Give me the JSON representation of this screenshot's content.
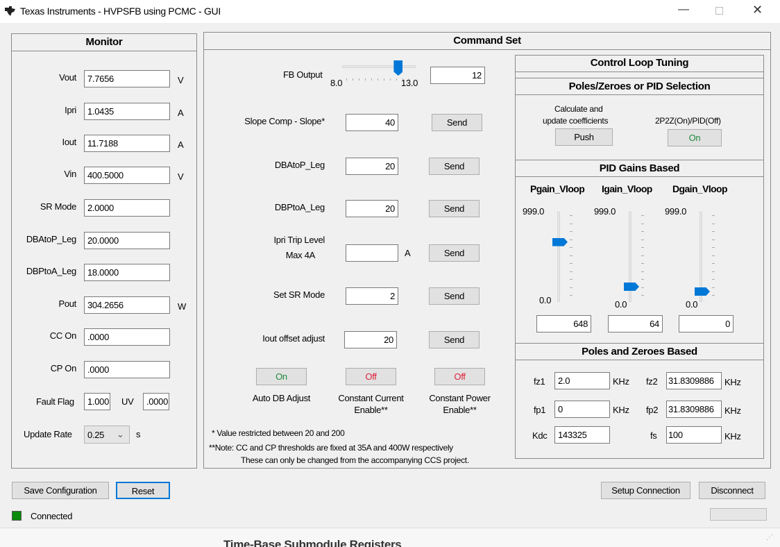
{
  "window": {
    "title": "Texas Instruments - HVPSFB using PCMC - GUI"
  },
  "monitor": {
    "title": "Monitor",
    "rows": [
      {
        "label": "Vout",
        "value": "7.7656",
        "unit": "V"
      },
      {
        "label": "Ipri",
        "value": "1.0435",
        "unit": "A"
      },
      {
        "label": "Iout",
        "value": "11.7188",
        "unit": "A"
      },
      {
        "label": "Vin",
        "value": "400.5000",
        "unit": "V"
      },
      {
        "label": "SR Mode",
        "value": "2.0000",
        "unit": ""
      },
      {
        "label": "DBAtoP_Leg",
        "value": "20.0000",
        "unit": ""
      },
      {
        "label": "DBPtoA_Leg",
        "value": "18.0000",
        "unit": ""
      },
      {
        "label": "Pout",
        "value": "304.2656",
        "unit": "W"
      },
      {
        "label": "CC On",
        "value": ".0000",
        "unit": ""
      },
      {
        "label": "CP On",
        "value": ".0000",
        "unit": ""
      }
    ],
    "fault_label": "Fault Flag",
    "fault_value": "1.000",
    "uv_label": "UV",
    "uv_value": ".0000",
    "update_label": "Update Rate",
    "update_value": "0.25",
    "update_unit": "s"
  },
  "command": {
    "title": "Command Set",
    "fb": {
      "label": "FB Output",
      "min": "8.0",
      "max": "13.0",
      "value": "12",
      "fraction": 0.8
    },
    "rows": [
      {
        "label": "Slope Comp - Slope*",
        "value": "40",
        "unit": "",
        "send": "Send"
      },
      {
        "label": "DBAtoP_Leg",
        "value": "20",
        "unit": "",
        "send": "Send"
      },
      {
        "label": "DBPtoA_Leg",
        "value": "20",
        "unit": "",
        "send": "Send"
      },
      {
        "label": "Ipri Trip Level",
        "label2": "Max 4A",
        "value": "",
        "unit": "A",
        "send": "Send"
      },
      {
        "label": "Set SR Mode",
        "value": "2",
        "unit": "",
        "send": "Send"
      },
      {
        "label": "Iout offset adjust",
        "value": "20",
        "unit": "",
        "send": "Send"
      }
    ],
    "toggles": [
      {
        "state": "On",
        "label": "Auto DB Adjust",
        "label2": ""
      },
      {
        "state": "Off",
        "label": "Constant Current",
        "label2": "Enable**"
      },
      {
        "state": "Off",
        "label": "Constant Power",
        "label2": "Enable**"
      }
    ],
    "note1": "* Value restricted between 20 and 200",
    "note2": "**Note: CC and CP thresholds are fixed  at 35A and 400W respectively",
    "note3": "These can only be changed from the accompanying CCS project."
  },
  "tuning": {
    "title": "Control Loop Tuning",
    "selection_title": "Poles/Zeroes or PID Selection",
    "calc_label1": "Calculate and",
    "calc_label2": "update coefficients",
    "push": "Push",
    "mode_label": "2P2Z(On)/PID(Off)",
    "mode_state": "On",
    "pid_title": "PID Gains Based",
    "gains": [
      {
        "label": "Pgain_Vloop",
        "max": "999.0",
        "min": "0.0",
        "value": "648"
      },
      {
        "label": "Igain_Vloop",
        "max": "999.0",
        "min": "0.0",
        "value": "64"
      },
      {
        "label": "Dgain_Vloop",
        "max": "999.0",
        "min": "0.0",
        "value": "0"
      }
    ],
    "pz_title": "Poles and Zeroes Based",
    "pz": {
      "fz1": "2.0",
      "fz2": "31.8309886",
      "fp1": "0",
      "fp2": "31.8309886",
      "kdc": "143325",
      "fs": "100",
      "unit": "KHz",
      "fz1_label": "fz1",
      "fz2_label": "fz2",
      "fp1_label": "fp1",
      "fp2_label": "fp2",
      "kdc_label": "Kdc",
      "fs_label": "fs"
    }
  },
  "footer": {
    "save": "Save Configuration",
    "reset": "Reset",
    "setup": "Setup Connection",
    "disconnect": "Disconnect",
    "status": "Connected",
    "background_text": "Time-Base Submodule Registers"
  },
  "colors": {
    "on": "#1e8a3a",
    "off": "#e0203a",
    "accent": "#0078d7",
    "led": "#0a8a0a"
  }
}
